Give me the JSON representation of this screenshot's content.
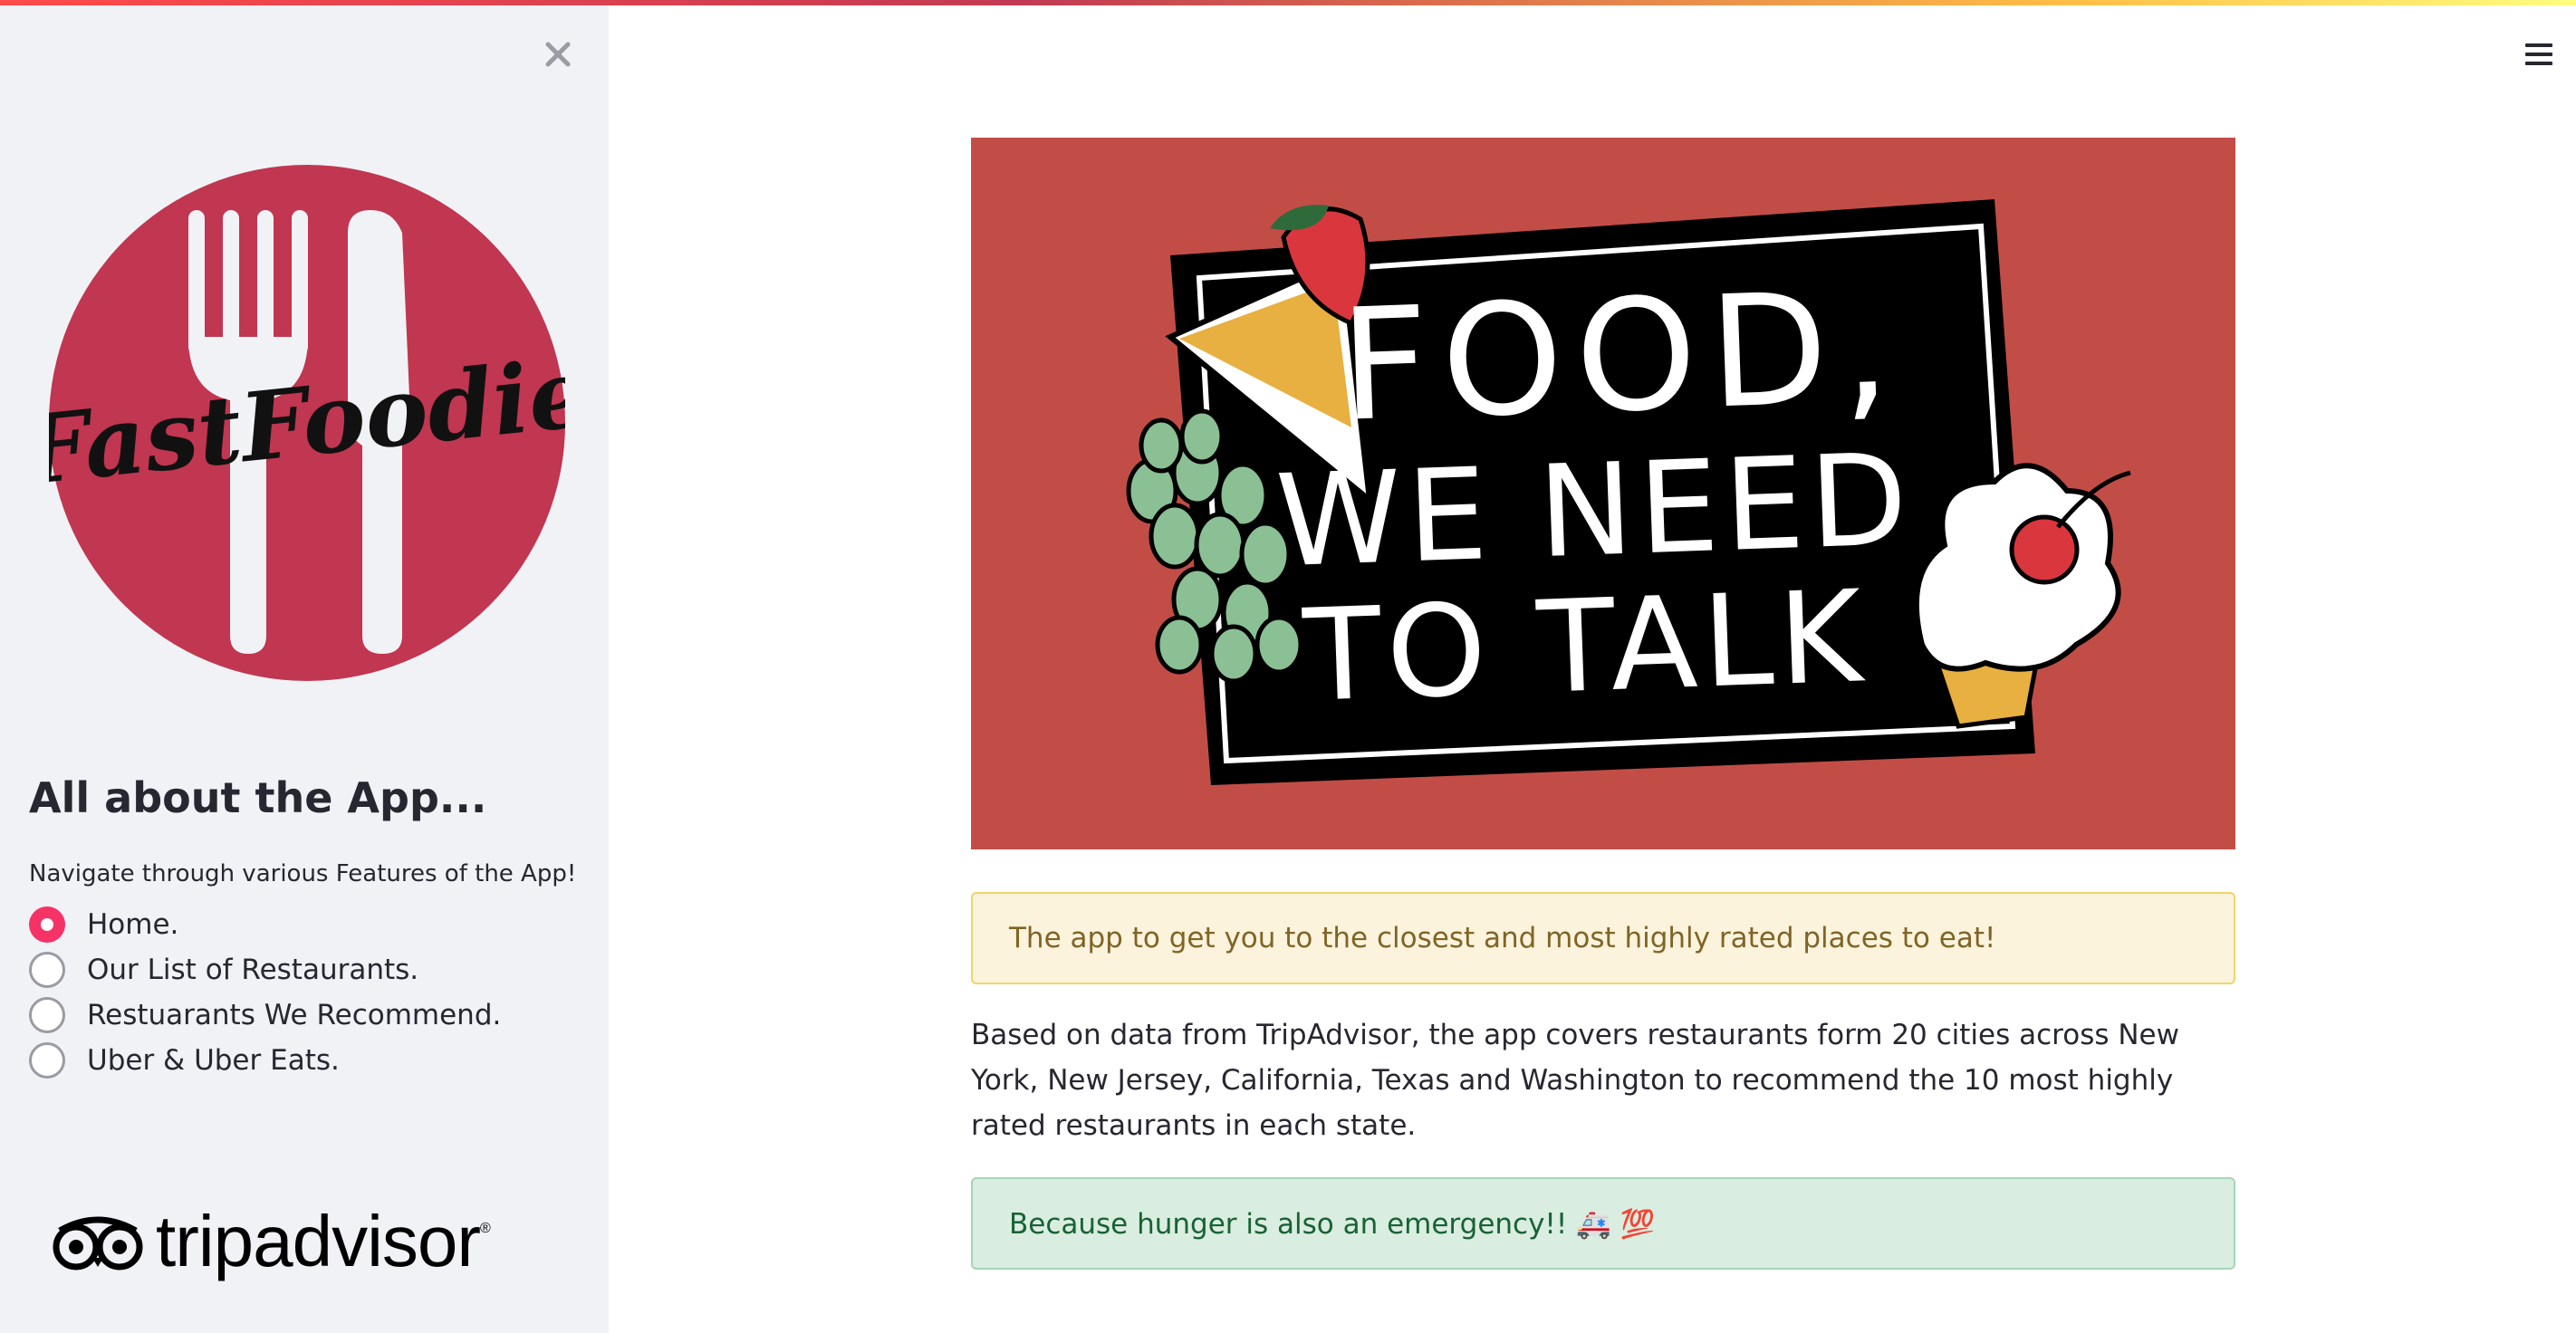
{
  "sidebar": {
    "logo_text": "FastFoodie",
    "heading": "All about the App...",
    "caption": "Navigate through various Features of the App!",
    "nav_options": [
      {
        "label": "Home.",
        "selected": true
      },
      {
        "label": "Our List of Restaurants.",
        "selected": false
      },
      {
        "label": "Restuarants We Recommend.",
        "selected": false
      },
      {
        "label": "Uber & Uber Eats.",
        "selected": false
      }
    ],
    "partner_logo_text": "tripadvisor",
    "partner_logo_reg": "®",
    "close_icon": "close-icon"
  },
  "header": {
    "menu_icon": "hamburger-icon"
  },
  "banner": {
    "line1": "FOOD,",
    "line2": "WE NEED",
    "line3": "TO TALK"
  },
  "main": {
    "warning_text": "The app to get you to the closest and most highly rated places to eat!",
    "body_text": "Based on data from TripAdvisor, the app covers restaurants form 20 cities across New York, New Jersey, California, Texas and Washington to recommend the 10 most highly rated restaurants in each state.",
    "success_text": "Because hunger is also an emergency!! 🚑 💯"
  },
  "colors": {
    "accent": "#f63366",
    "logo_red": "#c13650",
    "banner_bg": "#c24d47",
    "sidebar_bg": "#f0f2f6"
  }
}
